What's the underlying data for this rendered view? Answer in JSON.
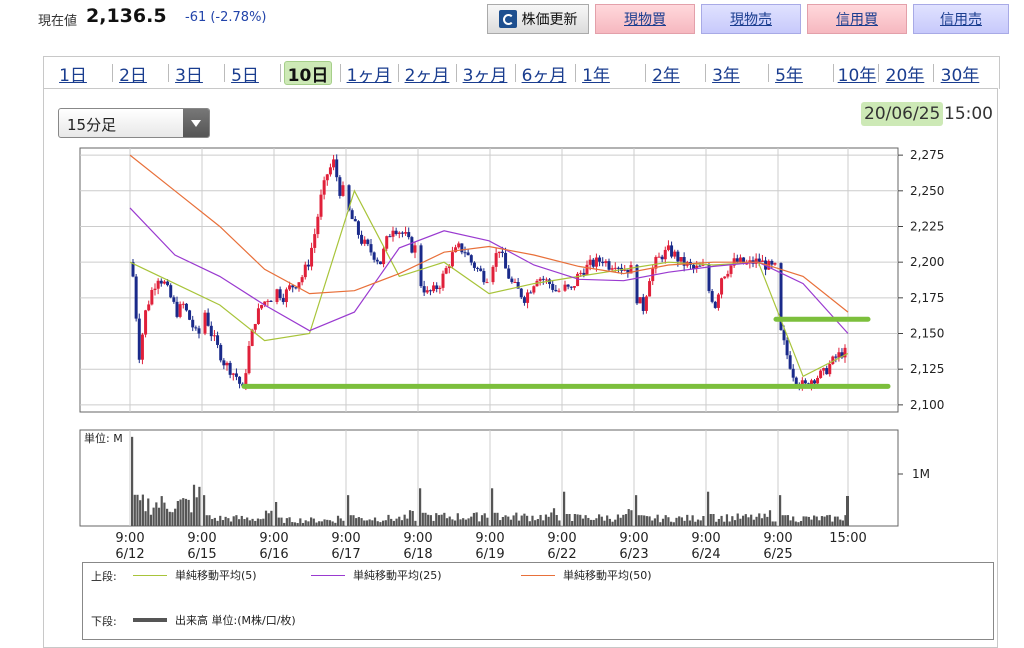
{
  "header": {
    "price_label": "現在値",
    "price_value": "2,136.5",
    "price_change": "-61 (-2.78%)",
    "buttons": {
      "refresh": "株価更新",
      "spot_buy": "現物買",
      "spot_sell": "現物売",
      "margin_buy": "信用買",
      "margin_sell": "信用売"
    }
  },
  "period_tabs": [
    "1日",
    "2日",
    "3日",
    "5日",
    "10日",
    "1ヶ月",
    "2ヶ月",
    "3ヶ月",
    "6ヶ月",
    "1年",
    "2年",
    "3年",
    "5年",
    "10年",
    "20年",
    "30年"
  ],
  "active_tab": "10日",
  "interval_select": {
    "value": "15分足"
  },
  "as_of": {
    "date": "20/06/25",
    "time": "15:00"
  },
  "colors": {
    "up": "#e0203a",
    "down": "#1a2a8a",
    "sma5": "#a8c43a",
    "sma25": "#9a3ad0",
    "sma50": "#e8703a",
    "volume": "#555555",
    "annotation": "#7cbf3c",
    "date_highlight": "#cde9b6"
  },
  "chart_data": {
    "type": "line",
    "price_axis": {
      "ticks": [
        2275,
        2250,
        2225,
        2200,
        2175,
        2150,
        2125,
        2100
      ],
      "tick_labels": [
        "2,275",
        "2,250",
        "2,225",
        "2,200",
        "2,175",
        "2,150",
        "2,125",
        "2,100"
      ],
      "ylim": [
        2095,
        2280
      ]
    },
    "volume_axis": {
      "unit_label": "単位: M",
      "tick_labels": [
        "1M"
      ]
    },
    "x_ticks": [
      {
        "time": "9:00",
        "date": "6/12"
      },
      {
        "time": "9:00",
        "date": "6/15"
      },
      {
        "time": "9:00",
        "date": "6/16"
      },
      {
        "time": "9:00",
        "date": "6/17"
      },
      {
        "time": "9:00",
        "date": "6/18"
      },
      {
        "time": "9:00",
        "date": "6/19"
      },
      {
        "time": "9:00",
        "date": "6/22"
      },
      {
        "time": "9:00",
        "date": "6/23"
      },
      {
        "time": "9:00",
        "date": "6/24"
      },
      {
        "time": "9:00",
        "date": "6/25"
      },
      {
        "time": "15:00",
        "date": ""
      }
    ],
    "session_close": [
      2190,
      2160,
      2182,
      2205,
      2185,
      2178,
      2196,
      2195,
      2198,
      2136.5
    ],
    "series": [
      {
        "name": "単純移動平均(5)",
        "key": "sma5",
        "values": [
          2200,
          2185,
          2170,
          2145,
          2150,
          2250,
          2190,
          2200,
          2178,
          2185,
          2190,
          2195,
          2200,
          2198,
          2200,
          2120,
          2136
        ]
      },
      {
        "name": "単純移動平均(25)",
        "key": "sma25",
        "values": [
          2238,
          2205,
          2190,
          2170,
          2152,
          2165,
          2210,
          2222,
          2215,
          2198,
          2188,
          2187,
          2193,
          2197,
          2200,
          2185,
          2150
        ]
      },
      {
        "name": "単純移動平均(50)",
        "key": "sma50",
        "values": [
          2275,
          2250,
          2225,
          2195,
          2178,
          2180,
          2192,
          2207,
          2211,
          2205,
          2197,
          2192,
          2198,
          2200,
          2200,
          2190,
          2165
        ]
      }
    ],
    "volume_peaks_m": [
      1.3,
      0.45,
      0.35,
      0.45,
      0.55,
      0.55,
      0.5,
      0.45,
      0.5,
      0.45,
      0.45,
      0.4
    ],
    "annotations": [
      {
        "kind": "horizontal-line",
        "price": 2113,
        "from_session": "6/16",
        "to": "15:00"
      },
      {
        "kind": "horizontal-line",
        "price": 2160,
        "from_session": "6/25",
        "to": "15:00"
      }
    ],
    "legend": {
      "upper_label": "上段:",
      "lower_label": "下段:",
      "volume_name": "出来高 単位:(M株/口/枚)"
    }
  }
}
